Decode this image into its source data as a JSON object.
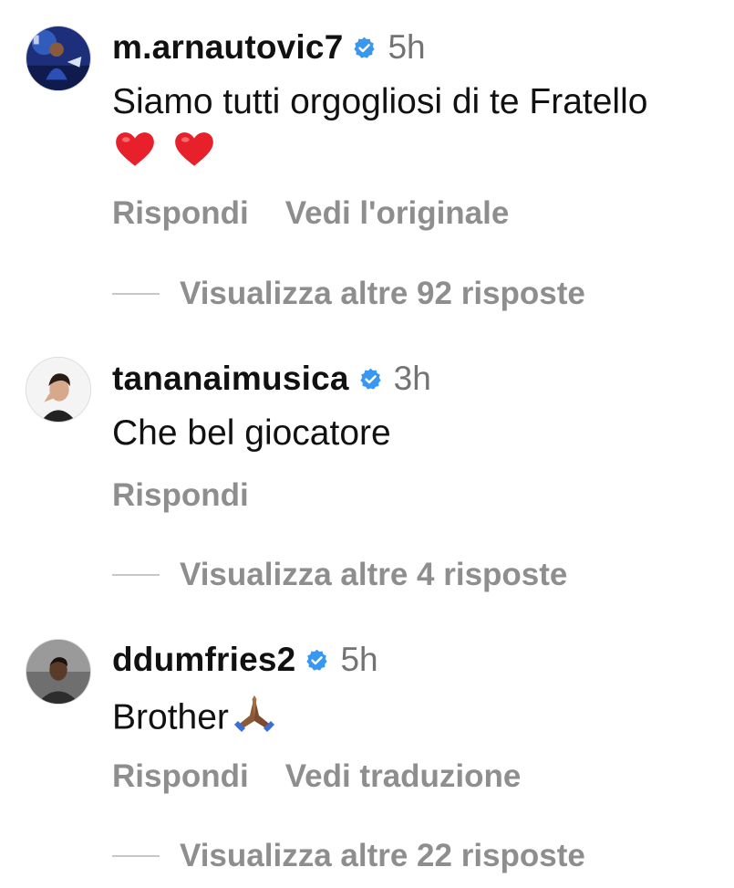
{
  "comments": [
    {
      "username": "m.arnautovic7",
      "time": "5h",
      "text_line1": "Siamo tutti orgogliosi di te Fratello",
      "emoji": "heart-emoji x2",
      "actions": [
        "Rispondi",
        "Vedi l'originale"
      ],
      "replies": "Visualizza altre 92 risposte"
    },
    {
      "username": "tananaimusica",
      "time": "3h",
      "text_line1": "Che bel giocatore",
      "actions": [
        "Rispondi"
      ],
      "replies": "Visualizza altre 4 risposte"
    },
    {
      "username": "ddumfries2",
      "time": "5h",
      "text_line1": "Brother",
      "emoji": "folded-hands-emoji",
      "actions": [
        "Rispondi",
        "Vedi traduzione"
      ],
      "replies": "Visualizza altre 22 risposte"
    }
  ],
  "colors": {
    "verified": "#3897f0",
    "secondary_text": "#8e8e8e",
    "timestamp": "#737373",
    "primary_text": "#111111"
  }
}
